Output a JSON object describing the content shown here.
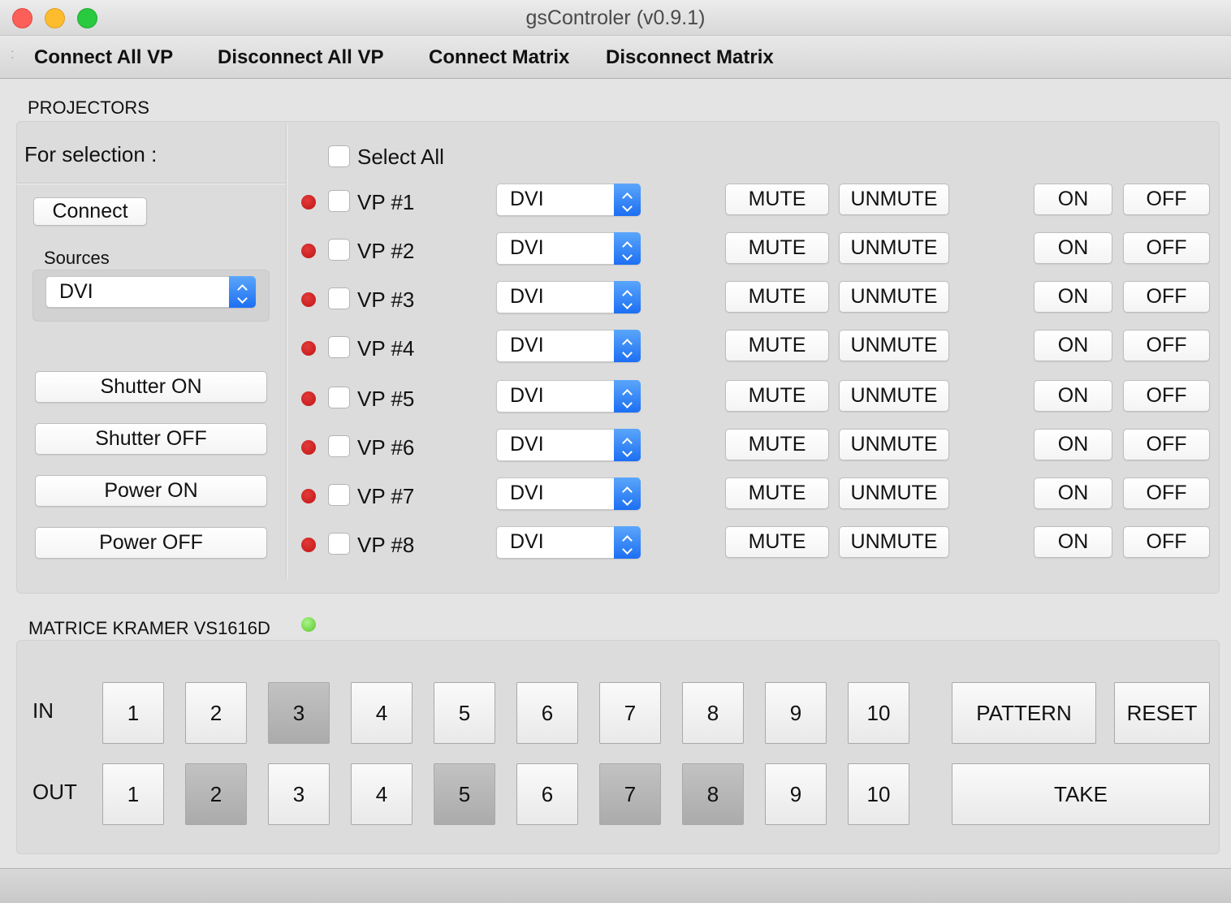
{
  "window": {
    "title": "gsControler (v0.9.1)"
  },
  "menu": [
    "Connect All VP",
    "Disconnect All VP",
    "Connect Matrix",
    "Disconnect Matrix"
  ],
  "projectors": {
    "section_title": "PROJECTORS",
    "for_selection": "For selection :",
    "connect": "Connect",
    "sources_label": "Sources",
    "sources_value": "DVI",
    "shutter_on": "Shutter ON",
    "shutter_off": "Shutter OFF",
    "power_on": "Power ON",
    "power_off": "Power OFF",
    "select_all": "Select All",
    "mute": "MUTE",
    "unmute": "UNMUTE",
    "on": "ON",
    "off": "OFF",
    "status_color": "#c01515",
    "rows": [
      {
        "name": "VP #1",
        "source": "DVI"
      },
      {
        "name": "VP #2",
        "source": "DVI"
      },
      {
        "name": "VP #3",
        "source": "DVI"
      },
      {
        "name": "VP #4",
        "source": "DVI"
      },
      {
        "name": "VP #5",
        "source": "DVI"
      },
      {
        "name": "VP #6",
        "source": "DVI"
      },
      {
        "name": "VP #7",
        "source": "DVI"
      },
      {
        "name": "VP #8",
        "source": "DVI"
      }
    ]
  },
  "matrix": {
    "title": "MATRICE KRAMER VS1616D",
    "status_color": "#5cc52a",
    "in_label": "IN",
    "out_label": "OUT",
    "in_buttons": [
      "1",
      "2",
      "3",
      "4",
      "5",
      "6",
      "7",
      "8",
      "9",
      "10"
    ],
    "out_buttons": [
      "1",
      "2",
      "3",
      "4",
      "5",
      "6",
      "7",
      "8",
      "9",
      "10"
    ],
    "in_selected": [
      "3"
    ],
    "out_selected": [
      "2",
      "5",
      "7",
      "8"
    ],
    "pattern": "PATTERN",
    "reset": "RESET",
    "take": "TAKE"
  }
}
